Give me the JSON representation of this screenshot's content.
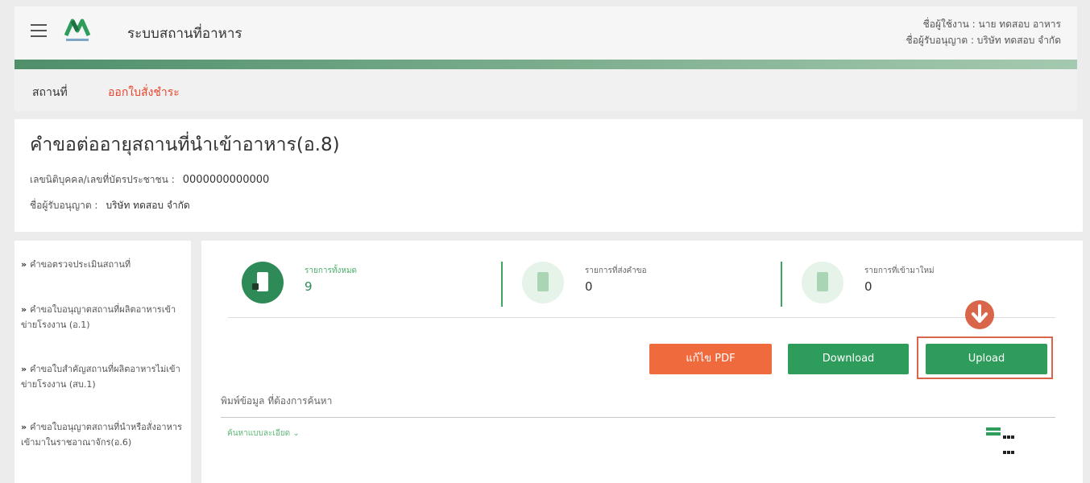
{
  "header": {
    "app_title": "ระบบสถานที่อาหาร",
    "username_line": "ชื่อผู้ใช้งาน : นาย ทดสอบ อาหาร",
    "licensee_line": "ชื่อผู้รับอนุญาต : บริษัท ทดสอบ จำกัด"
  },
  "tabs": [
    {
      "label": "สถานที่"
    },
    {
      "label": "ออกใบสั่งชำระ"
    }
  ],
  "title_card": {
    "title": "คำขอต่ออายุสถานที่นำเข้าอาหาร(อ.8)",
    "id_label": "เลขนิติบุคคล/เลขที่บัตรประชาชน :",
    "id_value": "0000000000000",
    "licensee_label": "ชื่อผู้รับอนุญาต :",
    "licensee_value": "บริษัท ทดสอบ จำกัด"
  },
  "sidebar": {
    "items": [
      {
        "arrow": "»",
        "label": "คำขอตรวจประเมินสถานที่"
      },
      {
        "arrow": "»",
        "label": "คำขอใบอนุญาตสถานที่ผลิตอาหารเข้าข่ายโรงงาน (อ.1)"
      },
      {
        "arrow": "»",
        "label": "คำขอใบสำคัญสถานที่ผลิตอาหารไม่เข้าข่ายโรงงาน (สบ.1)"
      },
      {
        "arrow": "»",
        "label": "คำขอใบอนุญาตสถานที่นำหรือสั่งอาหารเข้ามาในราชอาณาจักร(อ.6)"
      }
    ]
  },
  "stats": [
    {
      "label": "รายการทั้งหมด",
      "value": "9"
    },
    {
      "label": "รายการที่ส่งคำขอ",
      "value": "0"
    },
    {
      "label": "รายการที่เข้ามาใหม่",
      "value": "0"
    }
  ],
  "buttons": {
    "pdf": "แก้ไข PDF",
    "download": "Download",
    "upload": "Upload"
  },
  "search": {
    "label": "พิมพ์ข้อมูล ที่ต้องการค้นหา",
    "advanced": "ค้นหาแบบละเอียด ⌄"
  },
  "colors": {
    "brand_green": "#2e9d5b",
    "accent_orange": "#ef6b3e",
    "highlight_red": "#d9654a"
  }
}
